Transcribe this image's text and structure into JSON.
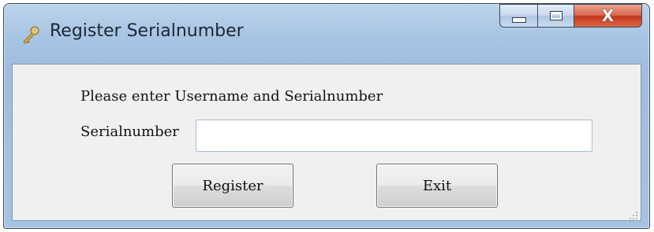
{
  "window": {
    "title": "Register Serialnumber",
    "icon": "key-icon",
    "controls": {
      "minimize": "minimize-icon",
      "maximize": "maximize-icon",
      "close": "X"
    }
  },
  "form": {
    "prompt": "Please enter Username and Serialnumber",
    "serial_label": "Serialnumber",
    "serial_value": "",
    "serial_placeholder": ""
  },
  "buttons": {
    "register_label": "Register",
    "exit_label": "Exit"
  },
  "colors": {
    "titlebar": "#a9c5e4",
    "close_button": "#c4361a",
    "client_background": "#f0f0f0"
  }
}
